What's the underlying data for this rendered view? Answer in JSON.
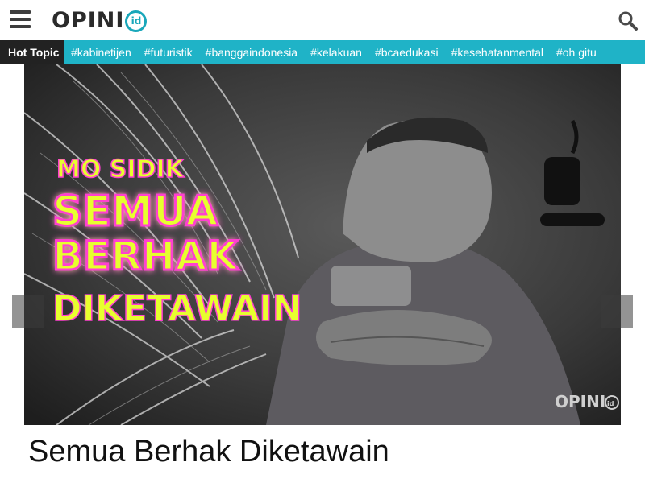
{
  "header": {
    "logo_text": "OPINI",
    "logo_badge": "id",
    "menu_icon": "hamburger-menu-icon",
    "search_icon": "search-icon"
  },
  "hot_topic": {
    "label": "Hot Topic",
    "tags": [
      "#kabinetijen",
      "#futuristik",
      "#banggaindonesia",
      "#kelakuan",
      "#bcaedukasi",
      "#kesehatanmental",
      "#oh gitu"
    ]
  },
  "featured": {
    "image_text": {
      "line1": "MO SIDIK",
      "line2": "SEMUA",
      "line3": "BERHAK",
      "line4": "DIKETAWAIN",
      "watermark": "OPINI",
      "watermark_badge": "id"
    },
    "title": "Semua Berhak Diketawain"
  },
  "colors": {
    "accent": "#1fb3c7",
    "hot_label_bg": "#222222",
    "neon_yellow": "#e7ff2e",
    "neon_pink": "#ff3fd0"
  }
}
